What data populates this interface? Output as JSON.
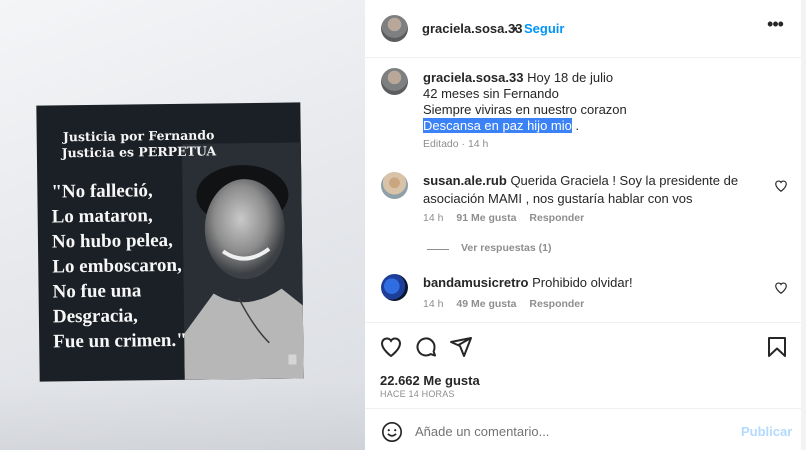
{
  "post": {
    "username": "graciela.sosa.33",
    "separator": "•",
    "follow_label": "Seguir",
    "more_label": "•••"
  },
  "image_text": {
    "heading_1": "Justicia por Fernando",
    "heading_2": "Justicia es PERPETUA",
    "quote_lines": [
      "\"No falleció,",
      "Lo mataron,",
      "No hubo pelea,",
      "Lo emboscaron,",
      "No fue una",
      "Desgracia,",
      "Fue un crimen.\""
    ]
  },
  "caption": {
    "username": "graciela.sosa.33",
    "line_1": "Hoy 18 de julio",
    "line_2": "42 meses sin Fernando",
    "line_3": "Siempre viviras en nuestro corazon",
    "line_4_highlighted": "Descansa en paz hijo mio",
    "line_4_tail": ".",
    "meta": "Editado · 14 h"
  },
  "comments": [
    {
      "username": "susan.ale.rub",
      "text": "Querida Graciela ! Soy la presidente de asociación MAMI , nos gustaría hablar con vos",
      "time": "14 h",
      "likes": "91 Me gusta",
      "reply": "Responder"
    },
    {
      "username": "bandamusicretro",
      "text": "Prohibido olvidar!",
      "time": "14 h",
      "likes": "49 Me gusta",
      "reply": "Responder"
    }
  ],
  "replies_link": "Ver respuestas (1)",
  "stats": {
    "likes": "22.662 Me gusta",
    "time": "HACE 14 HORAS"
  },
  "composer": {
    "placeholder": "Añade un comentario...",
    "post_label": "Publicar"
  },
  "colors": {
    "accent": "#0095f6",
    "highlight": "#3b82f6"
  },
  "icons": [
    "heart-icon",
    "comment-icon",
    "share-icon",
    "bookmark-icon",
    "emoji-icon",
    "more-icon"
  ]
}
